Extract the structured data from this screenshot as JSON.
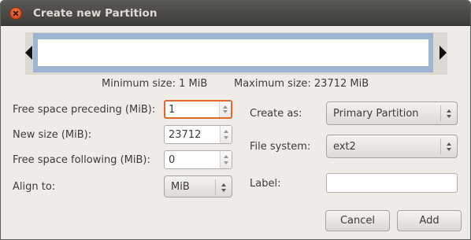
{
  "window": {
    "title": "Create new Partition"
  },
  "partition_info": {
    "min_size": "Minimum size: 1 MiB",
    "max_size": "Maximum size: 23712 MiB"
  },
  "fields": {
    "free_preceding_label": "Free space preceding (MiB):",
    "free_preceding_value": "1",
    "new_size_label": "New size (MiB):",
    "new_size_value": "23712",
    "free_following_label": "Free space following (MiB):",
    "free_following_value": "0",
    "align_label": "Align to:",
    "align_value": "MiB",
    "create_as_label": "Create as:",
    "create_as_value": "Primary Partition",
    "file_system_label": "File system:",
    "file_system_value": "ext2",
    "label_label": "Label:",
    "label_value": ""
  },
  "buttons": {
    "cancel": "Cancel",
    "add": "Add"
  },
  "icons": {
    "close": "close-icon",
    "spin_up": "arrow-up-icon",
    "spin_down": "arrow-down-icon"
  },
  "colors": {
    "titlebar": "#3d3c38",
    "focus": "#e2672a",
    "partition_border": "#9db5d1"
  }
}
